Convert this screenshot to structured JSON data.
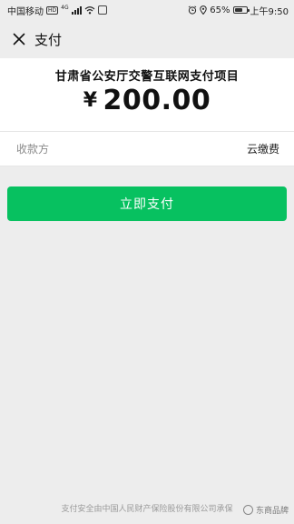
{
  "status_bar": {
    "carrier": "中国移动",
    "hd_badge": "HD",
    "network": "4G",
    "battery_percent": "65%",
    "battery_level": 0.65,
    "time": "上午9:50"
  },
  "nav": {
    "title": "支付"
  },
  "payment": {
    "merchant_title": "甘肃省公安厅交警互联网支付项目",
    "currency_symbol": "¥",
    "amount": "200.00"
  },
  "payee": {
    "label": "收款方",
    "value": "云缴费"
  },
  "pay_button": {
    "label": "立即支付"
  },
  "footer": {
    "text": "支付安全由中国人民财产保险股份有限公司承保"
  },
  "watermark": {
    "text": "东商品牌"
  },
  "colors": {
    "primary_green": "#07c160",
    "background": "#ededed"
  }
}
